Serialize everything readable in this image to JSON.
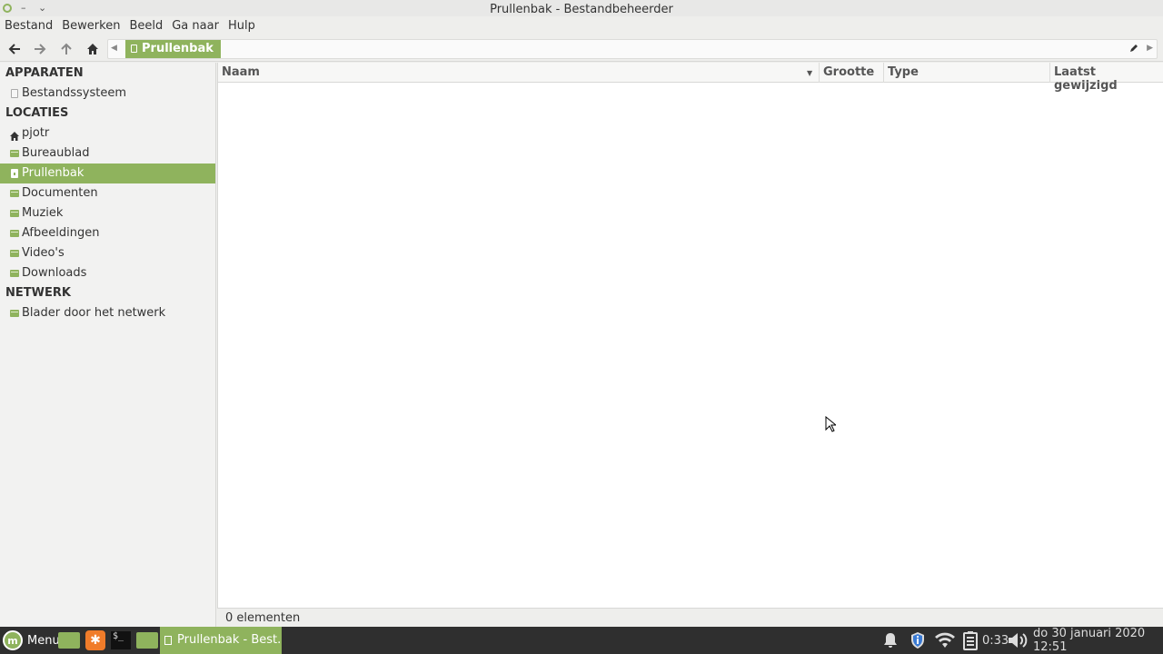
{
  "window": {
    "title": "Prullenbak - Bestandbeheerder",
    "controls": [
      "close",
      "minimize",
      "maximize"
    ]
  },
  "menubar": [
    "Bestand",
    "Bewerken",
    "Beeld",
    "Ga naar",
    "Hulp"
  ],
  "toolbar": {
    "breadcrumb": "Prullenbak"
  },
  "sidebar": {
    "sections": [
      {
        "title": "APPARATEN",
        "items": [
          {
            "label": "Bestandssysteem",
            "icon": "drive-icon"
          }
        ]
      },
      {
        "title": "LOCATIES",
        "items": [
          {
            "label": "pjotr",
            "icon": "home-icon"
          },
          {
            "label": "Bureaublad",
            "icon": "folder-icon"
          },
          {
            "label": "Prullenbak",
            "icon": "trash-icon",
            "active": true
          },
          {
            "label": "Documenten",
            "icon": "folder-icon"
          },
          {
            "label": "Muziek",
            "icon": "folder-icon"
          },
          {
            "label": "Afbeeldingen",
            "icon": "folder-icon"
          },
          {
            "label": "Video's",
            "icon": "folder-icon"
          },
          {
            "label": "Downloads",
            "icon": "folder-icon"
          }
        ]
      },
      {
        "title": "NETWERK",
        "items": [
          {
            "label": "Blader door het netwerk",
            "icon": "network-icon"
          }
        ]
      }
    ]
  },
  "columns": [
    "Naam",
    "Grootte",
    "Type",
    "Laatst gewijzigd"
  ],
  "status": "0 elementen",
  "taskbar": {
    "menu_label": "Menu",
    "window_button": "Prullenbak - Best...",
    "battery_time": "0:33",
    "clock": "do 30 januari 2020 12:51"
  },
  "colors": {
    "accent": "#8fb35d",
    "taskbar": "#2f2f2f"
  }
}
